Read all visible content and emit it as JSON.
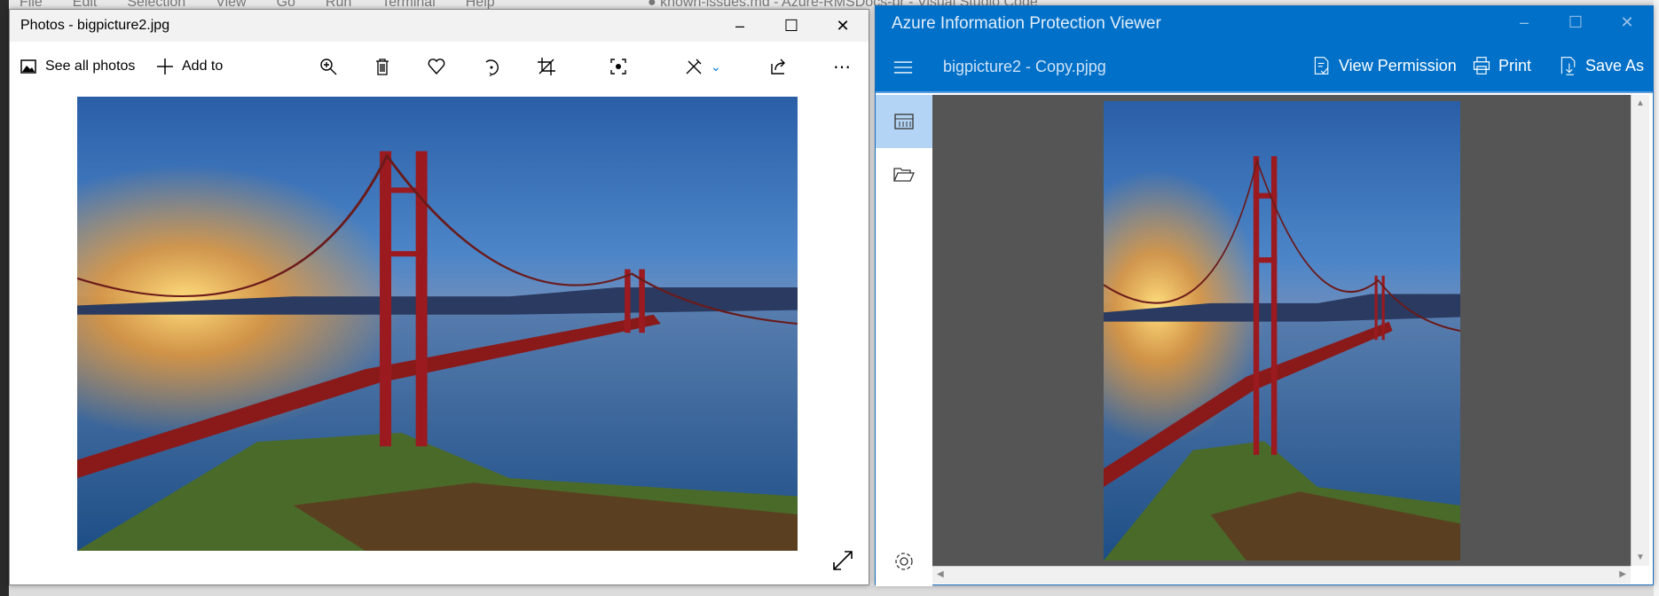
{
  "background": {
    "menu": [
      "File",
      "Edit",
      "Selection",
      "View",
      "Go",
      "Run",
      "Terminal",
      "Help"
    ],
    "title": "● known-issues.md - Azure-RMSDocs-pr - Visual Studio Code"
  },
  "photos": {
    "title": "Photos - bigpicture2.jpg",
    "toolbar": {
      "see_all": "See all photos",
      "add_to": "Add to"
    },
    "icons": [
      "zoom-in-icon",
      "delete-icon",
      "favorite-heart-icon",
      "rotate-icon",
      "crop-icon",
      "enhance-icon",
      "edit-draw-icon",
      "share-icon",
      "more-icon"
    ]
  },
  "aip": {
    "title": "Azure Information Protection Viewer",
    "file_name": "bigpicture2 - Copy.pjpg",
    "toolbar": {
      "view_permission": "View Permission",
      "print": "Print",
      "save_as": "Save As"
    },
    "accent": "#0070c8"
  }
}
